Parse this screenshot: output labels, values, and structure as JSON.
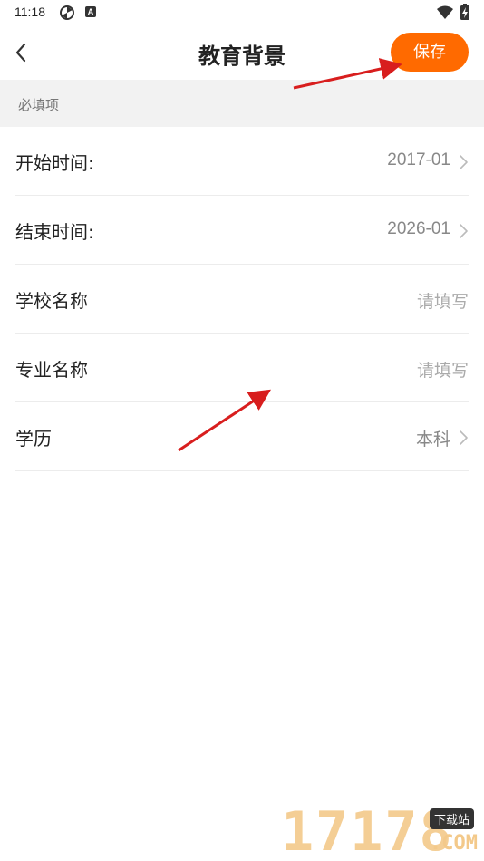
{
  "status_bar": {
    "time": "11:18",
    "notification_icon": "pinwheel-icon",
    "keyboard_icon_letter": "A",
    "wifi_icon": "wifi-icon",
    "battery_icon": "battery-charging-icon"
  },
  "nav": {
    "back_icon": "chevron-left-icon",
    "title": "教育背景",
    "save_label": "保存"
  },
  "section": {
    "label": "必填项"
  },
  "rows": [
    {
      "label": "开始时间:",
      "value": "2017-01",
      "has_chevron": true,
      "is_placeholder": false
    },
    {
      "label": "结束时间:",
      "value": "2026-01",
      "has_chevron": true,
      "is_placeholder": false
    },
    {
      "label": "学校名称",
      "value": "请填写",
      "has_chevron": false,
      "is_placeholder": true
    },
    {
      "label": "专业名称",
      "value": "请填写",
      "has_chevron": false,
      "is_placeholder": true
    },
    {
      "label": "学历",
      "value": "本科",
      "has_chevron": true,
      "is_placeholder": false
    }
  ],
  "watermark": {
    "digits": "17178",
    "badge": "下载站",
    "suffix": ".COM"
  },
  "colors": {
    "accent": "#ff6a00",
    "annotation_arrow": "#d81e1e",
    "section_bg": "#f2f2f2"
  }
}
